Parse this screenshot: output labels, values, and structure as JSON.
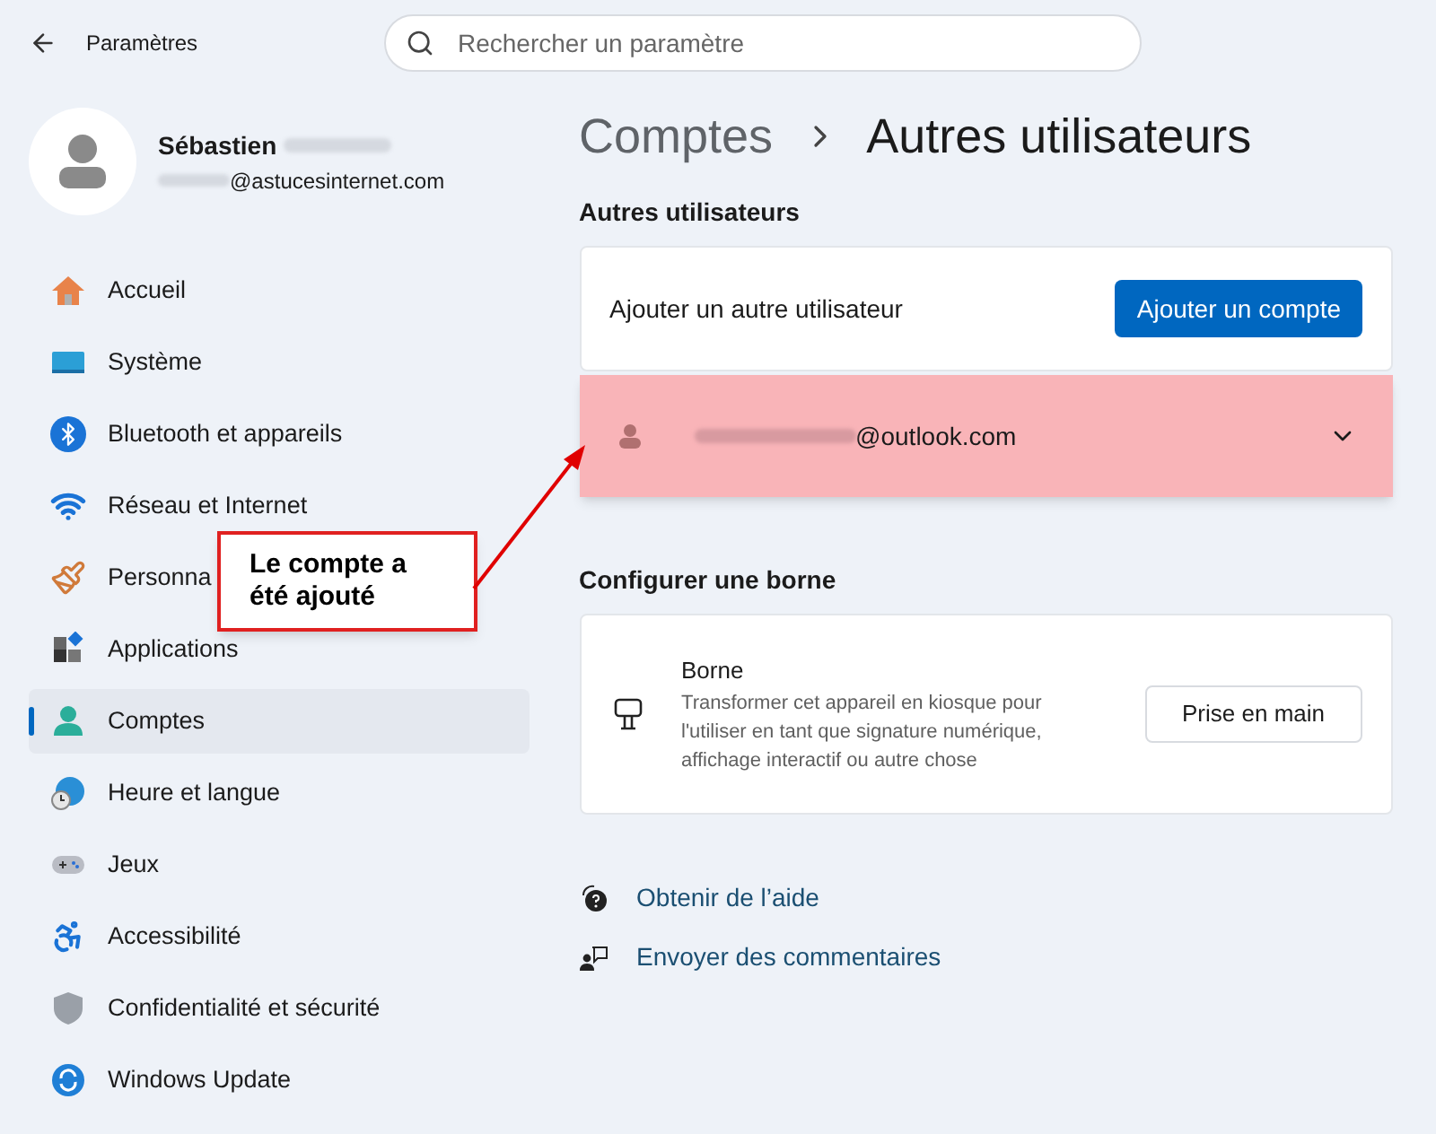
{
  "header": {
    "title": "Paramètres",
    "search": {
      "placeholder": "Rechercher un paramètre"
    }
  },
  "profile": {
    "name": "Sébastien",
    "email_suffix": "@astucesinternet.com"
  },
  "sidebar": {
    "items": [
      {
        "label": "Accueil",
        "kind": "home",
        "selected": false
      },
      {
        "label": "Système",
        "kind": "system",
        "selected": false
      },
      {
        "label": "Bluetooth et appareils",
        "kind": "bluetooth",
        "selected": false
      },
      {
        "label": "Réseau et Internet",
        "kind": "wifi",
        "selected": false
      },
      {
        "label": "Personna",
        "kind": "brush",
        "selected": false
      },
      {
        "label": "Applications",
        "kind": "apps",
        "selected": false
      },
      {
        "label": "Comptes",
        "kind": "accounts",
        "selected": true
      },
      {
        "label": "Heure et langue",
        "kind": "time",
        "selected": false
      },
      {
        "label": "Jeux",
        "kind": "games",
        "selected": false
      },
      {
        "label": "Accessibilité",
        "kind": "access",
        "selected": false
      },
      {
        "label": "Confidentialité et sécurité",
        "kind": "shield",
        "selected": false
      },
      {
        "label": "Windows Update",
        "kind": "update",
        "selected": false
      }
    ]
  },
  "breadcrumb": {
    "parent": "Comptes",
    "current": "Autres utilisateurs"
  },
  "other_users": {
    "heading": "Autres utilisateurs",
    "add_label": "Ajouter un autre utilisateur",
    "add_button": "Ajouter un compte",
    "users": [
      {
        "email_suffix": "@outlook.com",
        "highlighted": true,
        "expanded": false
      }
    ]
  },
  "kiosk": {
    "heading": "Configurer une borne",
    "title": "Borne",
    "description": "Transformer cet appareil en kiosque pour l'utiliser en tant que signature numérique, affichage interactif ou autre chose",
    "button": "Prise en main"
  },
  "links": [
    {
      "label": "Obtenir de l’aide",
      "kind": "help"
    },
    {
      "label": "Envoyer des commentaires",
      "kind": "feedback"
    }
  ],
  "callout": {
    "text": "Le compte a été ajouté"
  }
}
